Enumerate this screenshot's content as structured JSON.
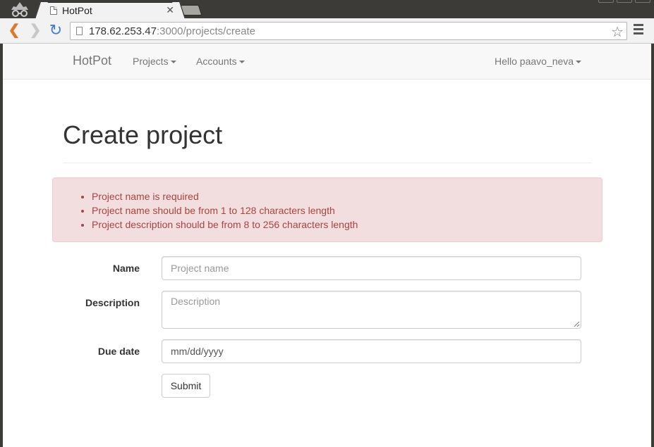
{
  "browser": {
    "tab_title": "HotPot",
    "url_host": "178.62.253.47",
    "url_rest": ":3000/projects/create"
  },
  "navbar": {
    "brand": "HotPot",
    "projects_menu": "Projects",
    "accounts_menu": "Accounts",
    "user_menu": "Hello paavo_neva"
  },
  "page": {
    "title": "Create project"
  },
  "errors": [
    "Project name is required",
    "Project name should be from 1 to 128 characters length",
    "Project description should be from 8 to 256 characters length"
  ],
  "form": {
    "name_label": "Name",
    "name_placeholder": "Project name",
    "description_label": "Description",
    "description_placeholder": "Description",
    "due_date_label": "Due date",
    "due_date_value": "mm/dd/yyyy",
    "submit_label": "Submit"
  },
  "colors": {
    "error_bg": "#f2dede",
    "error_text": "#a94442",
    "navbar_bg": "#f8f8f8"
  }
}
